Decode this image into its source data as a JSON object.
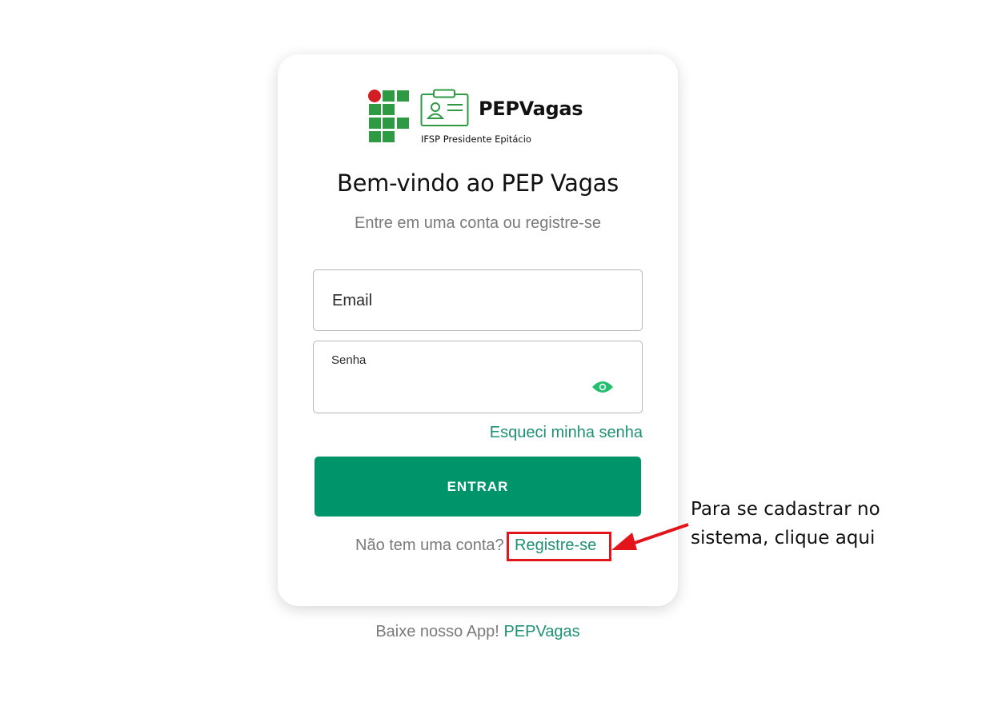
{
  "brand": {
    "name": "PEPVagas",
    "subtitle": "IFSP Presidente Epitácio",
    "logo_icon": "ifsp-logo-icon",
    "badge_icon": "id-badge-icon",
    "colors": {
      "green": "#2e9a43",
      "red": "#d11d23"
    }
  },
  "login": {
    "title": "Bem-vindo ao PEP Vagas",
    "subtitle": "Entre em uma conta ou registre-se",
    "email_label": "Email",
    "password_label": "Senha",
    "show_password_icon": "eye-icon",
    "forgot_password": "Esqueci minha senha",
    "submit_label": "ENTRAR",
    "no_account_text": "Não tem uma conta?",
    "register_link": "Registre-se"
  },
  "annotation": {
    "line1": "Para se cadastrar no",
    "line2": "sistema, clique aqui",
    "color": "#e4141b"
  },
  "footer": {
    "text": "Baixe nosso App!",
    "link": "PEPVagas"
  },
  "colors": {
    "accent": "#00946b",
    "link": "#1e9173"
  }
}
